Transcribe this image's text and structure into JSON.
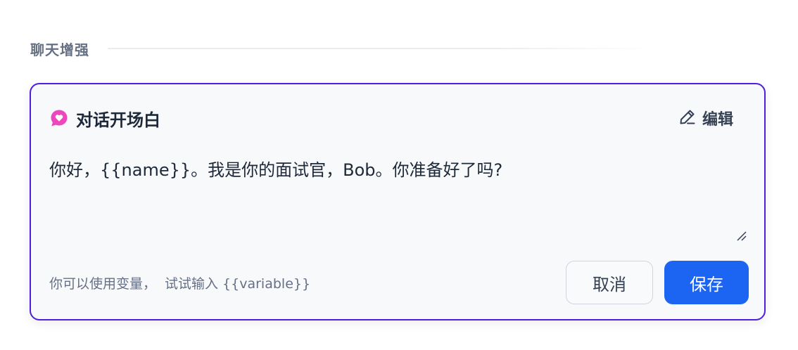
{
  "section": {
    "title": "聊天增强"
  },
  "opener": {
    "title": "对话开场白",
    "edit_label": "编辑",
    "text": "你好，{{name}}。我是你的面试官，Bob。你准备好了吗?",
    "hint_prefix": "你可以使用变量，",
    "hint_suffix": "试试输入 {{variable}}",
    "cancel_label": "取消",
    "save_label": "保存",
    "icon": "message-heart-icon",
    "edit_icon": "pencil-icon"
  },
  "colors": {
    "accent_border": "#4f1fe0",
    "primary_button": "#1c64f2",
    "icon_pink": "#ee46bc"
  }
}
